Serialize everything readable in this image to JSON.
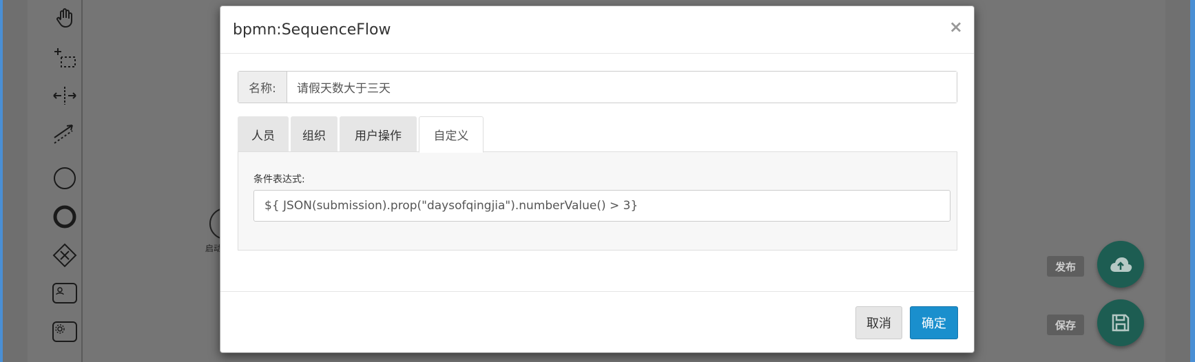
{
  "modal": {
    "title": "bpmn:SequenceFlow",
    "close": "×",
    "name_label": "名称:",
    "name_value": "请假天数大于三天",
    "tabs": [
      {
        "label": "人员"
      },
      {
        "label": "组织"
      },
      {
        "label": "用户操作"
      },
      {
        "label": "自定义"
      }
    ],
    "active_tab": "自定义",
    "condition_label": "条件表达式:",
    "condition_value": "${ JSON(submission).prop(\"daysofqingjia\").numberValue() > 3}",
    "cancel_label": "取消",
    "ok_label": "确定"
  },
  "canvas": {
    "start_event_label": "启动"
  },
  "actions": {
    "publish_label": "发布",
    "save_label": "保存"
  },
  "palette_icons": [
    "hand-tool-icon",
    "lasso-tool-icon",
    "space-tool-icon",
    "connect-tool-icon",
    "start-event-icon",
    "end-event-icon",
    "gateway-icon",
    "user-task-icon",
    "service-task-icon"
  ],
  "colors": {
    "primary_button": "#1a8fcd",
    "fab": "#1d5d52",
    "frame_border": "#4a8fd4"
  }
}
